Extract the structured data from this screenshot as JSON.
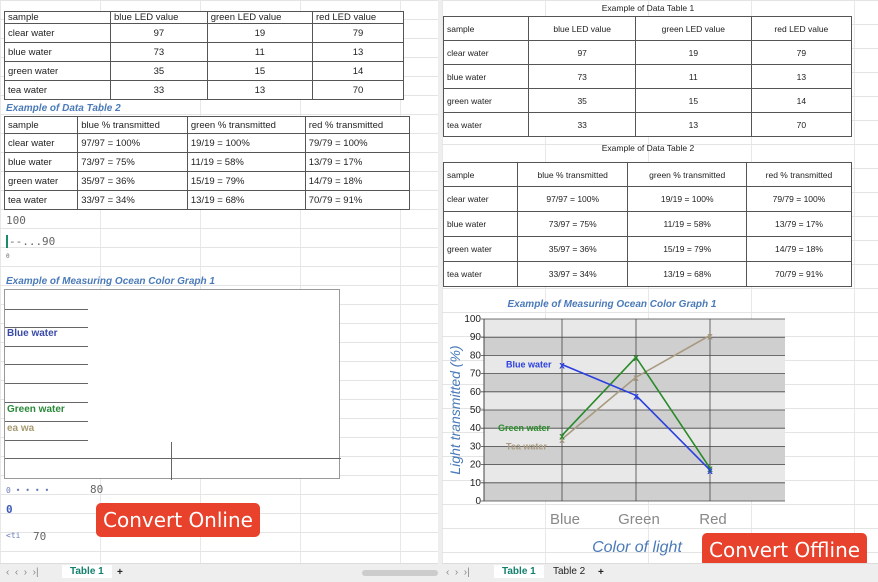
{
  "left": {
    "table1": {
      "headers": [
        "sample",
        "blue LED value",
        "green LED value",
        "red LED value"
      ],
      "rows": [
        [
          "clear water",
          "97",
          "19",
          "79"
        ],
        [
          "blue water",
          "73",
          "11",
          "13"
        ],
        [
          "green water",
          "35",
          "15",
          "14"
        ],
        [
          "tea water",
          "33",
          "13",
          "70"
        ]
      ]
    },
    "table2_title": "Example of Data Table 2",
    "table2": {
      "headers": [
        "sample",
        "blue % transmitted",
        "green % transmitted",
        "red % transmitted"
      ],
      "rows": [
        [
          "clear water",
          "97/97 = 100%",
          "19/19 = 100%",
          "79/79 = 100%"
        ],
        [
          "blue water",
          "73/97 = 75%",
          "11/19 = 58%",
          "13/79 = 17%"
        ],
        [
          "green water",
          "35/97 = 36%",
          "15/19 = 79%",
          "14/79 = 18%"
        ],
        [
          "tea water",
          "33/97 = 34%",
          "13/19 = 68%",
          "70/79 = 91%"
        ]
      ]
    },
    "frag_100": "100",
    "frag_90a": "--...",
    "frag_90": "90",
    "frag_0a": "0",
    "graph_title": "Example of Measuring Ocean Color Graph 1",
    "blue_water": "Blue water",
    "green_water": "Green water",
    "tea_wa": "ea wa",
    "frag_80a": "0 • • • •",
    "frag_80": "80",
    "frag_0": "0",
    "frag_70a": "<ti",
    "frag_70": "70",
    "convert": "Convert Online",
    "tabs": [
      "Table 1"
    ],
    "add": "+"
  },
  "right": {
    "table1_title": "Example of Data Table 1",
    "table2_title": "Example of Data Table 2",
    "convert": "Convert Offline",
    "tabs": [
      "Table 1",
      "Table 2"
    ],
    "add": "+"
  },
  "colors": {
    "blue": "#2a3fe0",
    "green": "#2a8a2a",
    "tea": "#a89a80",
    "accent": "#e8412c"
  },
  "chart_data": {
    "type": "line",
    "title": "Example of Measuring Ocean Color Graph 1",
    "xlabel": "Color of light",
    "ylabel": "Light transmitted (%)",
    "categories": [
      "Blue",
      "Green",
      "Red"
    ],
    "ylim": [
      0,
      100
    ],
    "yticks": [
      0,
      10,
      20,
      30,
      40,
      50,
      60,
      70,
      80,
      90,
      100
    ],
    "series": [
      {
        "name": "Blue water",
        "values": [
          75,
          58,
          17
        ]
      },
      {
        "name": "Green water",
        "values": [
          36,
          79,
          18
        ]
      },
      {
        "name": "Tea water",
        "values": [
          34,
          68,
          91
        ]
      }
    ]
  }
}
